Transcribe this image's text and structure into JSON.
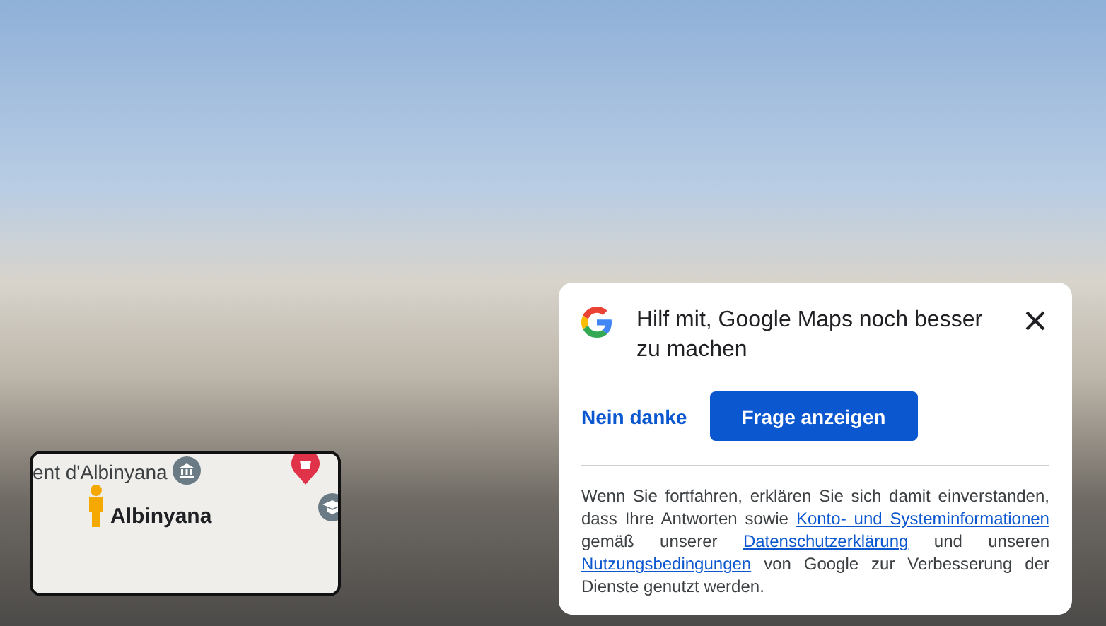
{
  "minimap": {
    "labels": [
      {
        "text": "ent d'Albinyana",
        "kind": "place"
      },
      {
        "text": "Albinyana",
        "kind": "town"
      }
    ]
  },
  "dialog": {
    "title": "Hilf mit, Google Maps noch besser zu machen",
    "decline": "Nein danke",
    "accept": "Frage anzeigen",
    "disclaimer": [
      {
        "kind": "text",
        "text": "Wenn Sie fortfahren, erklären Sie sich damit einverstanden, dass Ihre Antworten sowie "
      },
      {
        "kind": "link",
        "text": "Konto- und Systeminformationen"
      },
      {
        "kind": "text",
        "text": " gemäß unserer "
      },
      {
        "kind": "link",
        "text": "Datenschutzerklärung"
      },
      {
        "kind": "text",
        "text": " und unseren "
      },
      {
        "kind": "link",
        "text": "Nutzungsbedingungen"
      },
      {
        "kind": "text",
        "text": " von Google zur Verbesserung der Dienste genutzt werden."
      }
    ]
  }
}
